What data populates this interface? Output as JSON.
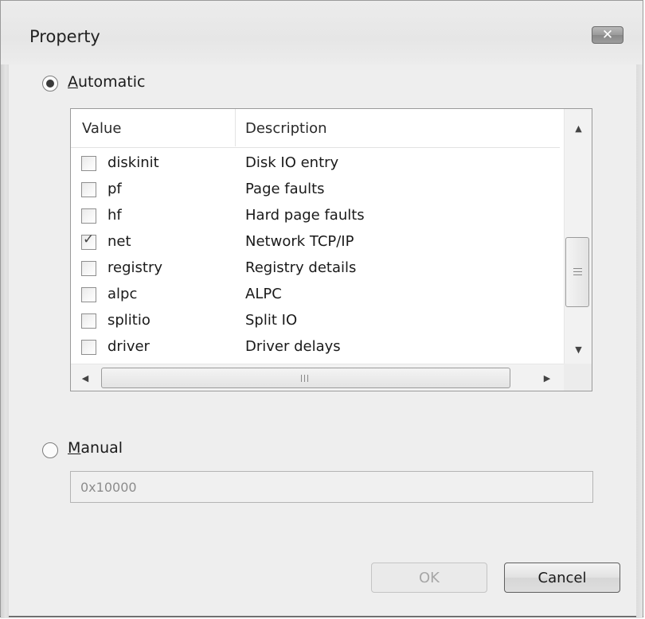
{
  "window": {
    "title": "Property",
    "close_icon": "close-icon"
  },
  "automatic": {
    "label": "Automatic",
    "selected": true
  },
  "list": {
    "columns": [
      "Value",
      "Description"
    ],
    "rows": [
      {
        "value": "diskinit",
        "description": "Disk IO entry",
        "checked": false
      },
      {
        "value": "pf",
        "description": "Page faults",
        "checked": false
      },
      {
        "value": "hf",
        "description": "Hard page faults",
        "checked": false
      },
      {
        "value": "net",
        "description": "Network TCP/IP",
        "checked": true
      },
      {
        "value": "registry",
        "description": "Registry details",
        "checked": false
      },
      {
        "value": "alpc",
        "description": "ALPC",
        "checked": false
      },
      {
        "value": "splitio",
        "description": "Split IO",
        "checked": false
      },
      {
        "value": "driver",
        "description": "Driver delays",
        "checked": false
      }
    ]
  },
  "manual": {
    "label": "Manual",
    "selected": false,
    "value": "0x10000"
  },
  "buttons": {
    "ok": "OK",
    "cancel": "Cancel"
  }
}
